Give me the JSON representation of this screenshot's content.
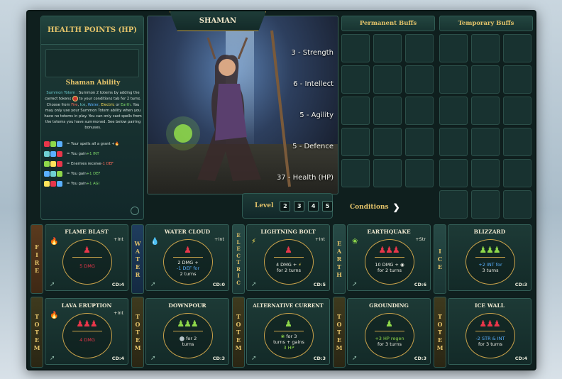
{
  "health": {
    "title": "HEALTH POINTS (HP)"
  },
  "ability": {
    "title": "Shaman Ability",
    "p1_lead": "Summon Totem :",
    "p1_a": " Summon 2 totems by adding the correct tokens",
    "p1_b": " to your conditions tab for 2 turns. Choose from ",
    "fire": "Fire",
    "comma1": ", ",
    "ice": "Ice",
    "comma2": ", ",
    "water": "Water",
    "comma3": ", ",
    "electric": "Electric",
    "or": " or ",
    "earth": "Earth",
    "p1_c": ". You may only use your Summon Totem ability when you have no totems in play. You can only cast spells from the totems you have summoned. See below pairing bonuses.",
    "bonuses": [
      {
        "lead": "= Your spells all a grant + ",
        "tail": ""
      },
      {
        "lead": "= You gain ",
        "tail": "+1 INT"
      },
      {
        "lead": "= Enemies receive ",
        "tail": "-1 DEF"
      },
      {
        "lead": "= You gain ",
        "tail": "+1 DEF"
      },
      {
        "lead": "= You gain ",
        "tail": "+1 AGI"
      }
    ]
  },
  "character": {
    "name": "SHAMAN",
    "stats": [
      "3 - Strength",
      "6 - Intellect",
      "5 - Agility",
      "5 - Defence",
      "37 - Health (HP)"
    ]
  },
  "buffs": {
    "permanent": "Permanent Buffs",
    "temporary": "Temporary Buffs"
  },
  "level": {
    "label": "Level",
    "values": [
      "2",
      "3",
      "4",
      "5"
    ]
  },
  "conditions": {
    "label": "Conditions"
  },
  "strips": {
    "fire": [
      "F",
      "I",
      "R",
      "E"
    ],
    "water": [
      "W",
      "A",
      "T",
      "E",
      "R"
    ],
    "electric": [
      "E",
      "L",
      "E",
      "C",
      "T",
      "R",
      "I",
      "C"
    ],
    "earth": [
      "E",
      "A",
      "R",
      "T",
      "H"
    ],
    "ice": [
      "I",
      "C",
      "E"
    ],
    "totem": [
      "T",
      "O",
      "T",
      "E",
      "M"
    ]
  },
  "spells": [
    {
      "title": "FLAME BLAST",
      "bonus": "+Int",
      "desc": "5 DMG",
      "cd": "CD:4"
    },
    {
      "title": "WATER CLOUD",
      "bonus": "+Int",
      "desc_a": "2 DMG +",
      "desc_b": "-1 DEF for",
      "desc_c": "2 turns",
      "cd": "CD:0"
    },
    {
      "title": "LIGHTNING BOLT",
      "bonus": "+Int",
      "desc_a": "4 DMG + ",
      "desc_b": "for 2 turns",
      "cd": "CD:5"
    },
    {
      "title": "EARTHQUAKE",
      "bonus": "+Str",
      "desc_a": "10 DMG + ",
      "desc_b": "for 2 turns",
      "cd": "CD:6"
    },
    {
      "title": "BLIZZARD",
      "bonus": "",
      "desc_a": "+2 INT for",
      "desc_b": "3 turns",
      "cd": "CD:3"
    },
    {
      "title": "LAVA ERUPTION",
      "bonus": "+Int",
      "desc": "4 DMG",
      "cd": "CD:4"
    },
    {
      "title": "DOWNPOUR",
      "bonus": "",
      "desc_a": "for 2",
      "desc_b": "turns",
      "cd": "CD:3"
    },
    {
      "title": "ALTERNATIVE CURRENT",
      "bonus": "",
      "desc_a": "for 3",
      "desc_b": "turns + gains",
      "desc_c": "3 HP",
      "cd": "CD:3"
    },
    {
      "title": "GROUNDING",
      "bonus": "",
      "desc_a": "+3 HP regen",
      "desc_b": "for 3 turns",
      "cd": "CD:3"
    },
    {
      "title": "ICE WALL",
      "bonus": "",
      "desc_a": "-2 STR & INT",
      "desc_b": "for 3 turns",
      "cd": "CD:4"
    }
  ],
  "colors": {
    "gold": "#e4c36a",
    "fire": "#e8364a",
    "earth": "#8ed84a",
    "water": "#5ab0ff",
    "electric": "#ffe45a"
  }
}
